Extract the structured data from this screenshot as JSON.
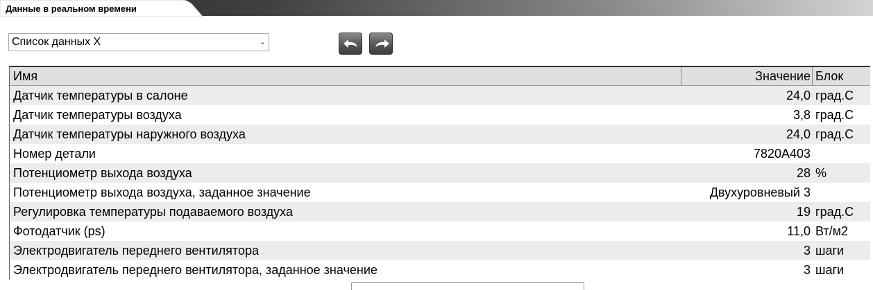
{
  "tab": {
    "title": "Данные в реальном времени"
  },
  "selector": {
    "value": "Список данных X"
  },
  "table": {
    "headers": {
      "name": "Имя",
      "value": "Значение",
      "unit": "Блок"
    },
    "rows": [
      {
        "name": "Датчик температуры в салоне",
        "value": "24,0",
        "unit": "град.С"
      },
      {
        "name": "Датчик температуры воздуха",
        "value": "3,8",
        "unit": "град.С"
      },
      {
        "name": "Датчик температуры наружного воздуха",
        "value": "24,0",
        "unit": "град.С"
      },
      {
        "name": "Номер детали",
        "value": "7820A403",
        "unit": ""
      },
      {
        "name": "Потенциометр выхода воздуха",
        "value": "28",
        "unit": "%"
      },
      {
        "name": "Потенциометр выхода воздуха, заданное значение",
        "value": "Двухуровневый 3",
        "unit": ""
      },
      {
        "name": "Регулировка температуры подаваемого воздуха",
        "value": "19",
        "unit": "град.С"
      },
      {
        "name": "Фотодатчик (ps)",
        "value": "11,0",
        "unit": "Вт/м2"
      },
      {
        "name": "Электродвигатель переднего вентилятора",
        "value": "3",
        "unit": "шаги"
      },
      {
        "name": "Электродвигатель переднего вентилятора, заданное значение",
        "value": "3",
        "unit": "шаги"
      }
    ]
  }
}
